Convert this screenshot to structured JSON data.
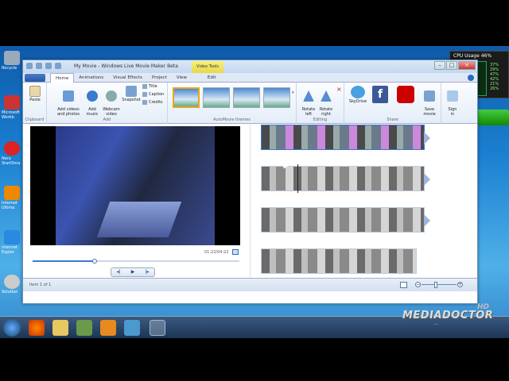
{
  "window": {
    "title": "My Movie - Windows Live Movie Maker Beta",
    "contextual_tab": "Video Tools"
  },
  "tabs": [
    "Home",
    "Animations",
    "Visual Effects",
    "Project",
    "View",
    "Edit"
  ],
  "ribbon": {
    "clipboard": {
      "paste": "Paste",
      "group": "Clipboard"
    },
    "add": {
      "add_videos": "Add videos\nand photos",
      "add_music": "Add\nmusic",
      "webcam": "Webcam\nvideo",
      "snapshot": "Snapshot",
      "title": "Title",
      "caption": "Caption",
      "credits": "Credits",
      "group": "Add"
    },
    "themes": {
      "group": "AutoMovie themes"
    },
    "editing": {
      "rotate_left": "Rotate\nleft",
      "rotate_right": "Rotate\nright",
      "group": "Editing"
    },
    "share": {
      "skydrive": "SkyDrive",
      "save_movie": "Save\nmovie",
      "group": "Share"
    },
    "signin": "Sign\nin"
  },
  "preview": {
    "timecode": "01:22/04:22",
    "progress": 0.3
  },
  "status": {
    "text": "Item 1 of 1"
  },
  "gadget": {
    "title": "CPU Usage",
    "percent": "46%",
    "vals": [
      "37%",
      "29%",
      "47%",
      "42%",
      "21%",
      "26%"
    ]
  },
  "desktop_icons": [
    {
      "label": "Recycle",
      "color": "#9ab"
    },
    {
      "label": "Microsoft\nWorkb",
      "color": "#c33"
    },
    {
      "label": "Nero\nStartSma",
      "color": "#d22"
    },
    {
      "label": "Internet\nUltima",
      "color": "#e80"
    },
    {
      "label": "Internet\nExplor",
      "color": "#2a8ae0"
    },
    {
      "label": "Solution",
      "color": "#ccc"
    }
  ],
  "watermark": {
    "hd": "HD",
    "name": "MEDIADOCTOR",
    "sub": "..."
  },
  "colors": {
    "accent": "#3a7ad0",
    "ribbon": "#e4edf8",
    "theme_selected": "#e8a520"
  }
}
